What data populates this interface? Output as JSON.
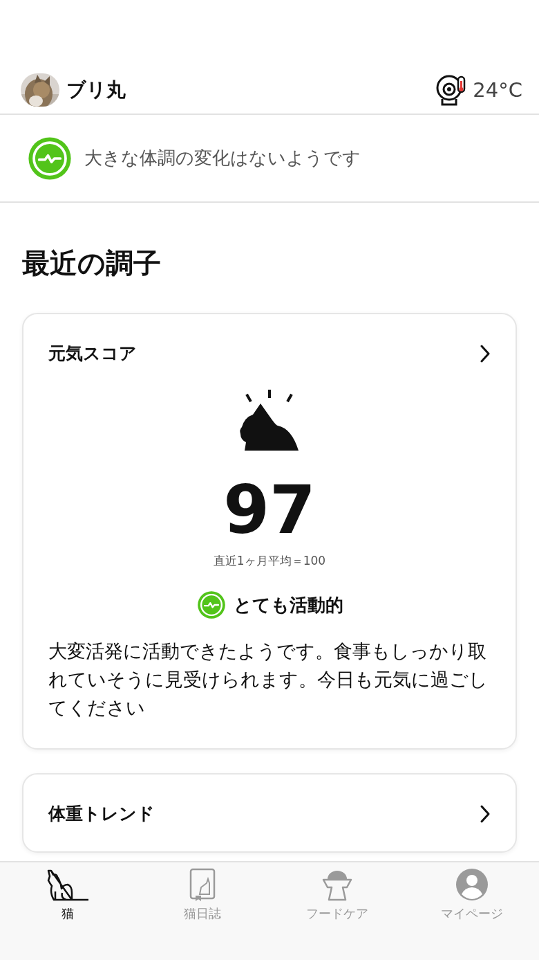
{
  "header": {
    "cat_name": "ブリ丸",
    "temperature": "24°C"
  },
  "status": {
    "message": "大きな体調の変化はないようです"
  },
  "section_title": "最近の調子",
  "cards": [
    {
      "kind": "score",
      "title": "元気スコア",
      "score": "97",
      "average": "直近1ヶ月平均＝100",
      "rating": "とても活動的",
      "description": "大変活発に活動できたようです。食事もしっかり取れていそうに見受けられます。今日も元気に過ごしてください"
    },
    {
      "kind": "trend",
      "title": "体重トレンド"
    }
  ],
  "tabs": [
    {
      "label": "猫",
      "selected": true
    },
    {
      "label": "猫日誌",
      "selected": false
    },
    {
      "label": "フードケア",
      "selected": false
    },
    {
      "label": "マイページ",
      "selected": false
    }
  ]
}
